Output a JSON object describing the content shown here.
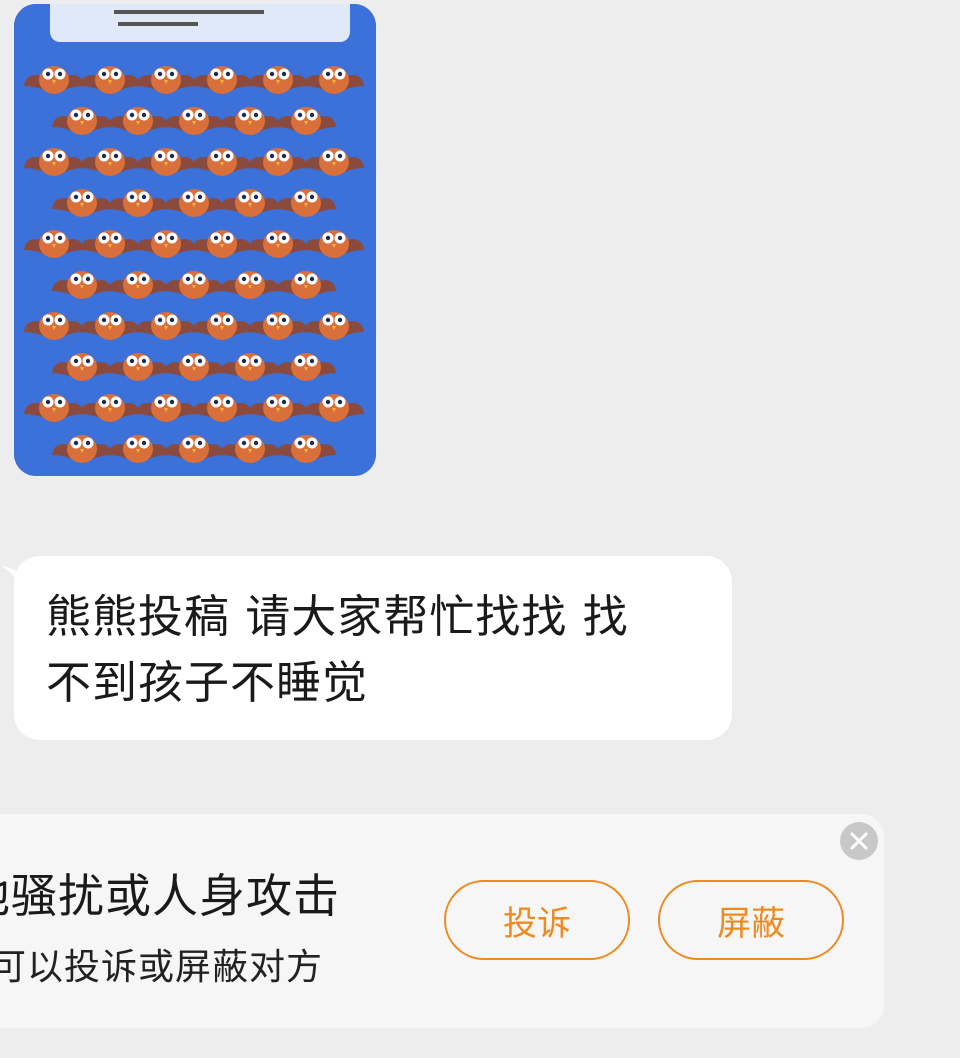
{
  "message": {
    "text_line1": "熊熊投稿 请大家帮忙找找 找",
    "text_line2": "不到孩子不睡觉"
  },
  "image_message": {
    "subject": "owl pattern puzzle image",
    "colors": {
      "background": "#3b71d8",
      "owl_body": "#d96f3a",
      "owl_wing": "#8a4a3d"
    }
  },
  "warning": {
    "title": "他骚扰或人身攻击",
    "subtitle": "可以投诉或屏蔽对方",
    "report_label": "投诉",
    "block_label": "屏蔽",
    "close_icon": "close-icon"
  },
  "colors": {
    "accent": "#ee8a1f",
    "page_bg": "#ededed",
    "bubble_bg": "#ffffff"
  }
}
